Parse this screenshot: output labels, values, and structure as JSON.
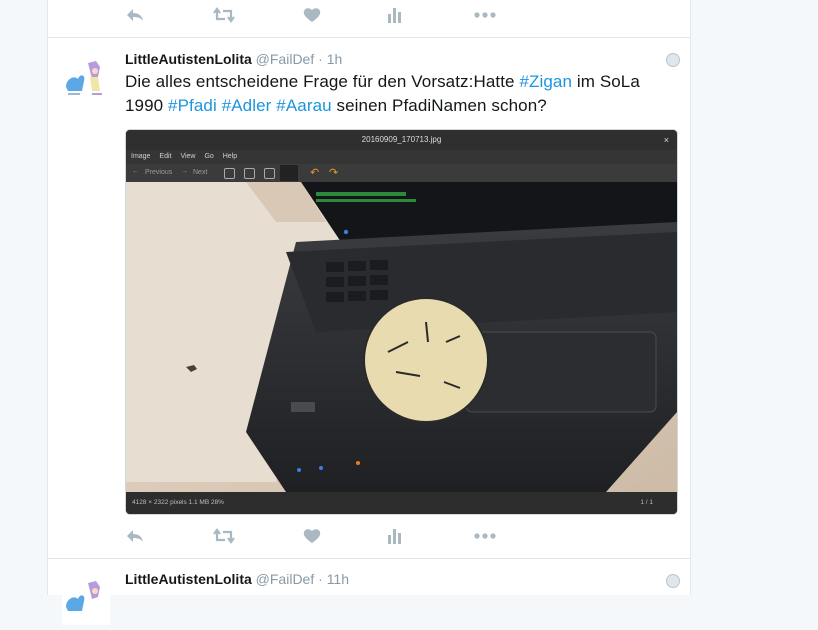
{
  "actions": {
    "reply_icon": "reply-icon",
    "retweet_icon": "retweet-icon",
    "like_icon": "heart-icon",
    "analytics_icon": "bar-chart-icon",
    "more_icon": "more-icon"
  },
  "tweets": [
    {
      "name": "LittleAutistenLolita",
      "handle": "@FailDef",
      "dot": "·",
      "time": "1h",
      "text": {
        "p1": "Die alles entscheidene Frage für den Vorsatz:Hatte ",
        "h1": "#Zigan",
        "p2": " im SoLa 1990 ",
        "h2": "#Pfadi",
        "h3": "#Adler",
        "h4": "#Aarau",
        "p3": " seinen PfadiNamen schon?"
      },
      "media": {
        "window_title": "20160909_170713.jpg",
        "close": "×",
        "menu": [
          "Image",
          "Edit",
          "View",
          "Go",
          "Help"
        ],
        "prev": "Previous",
        "next": "Next",
        "status_left": "4128 × 2322 pixels  1.1 MB   28%",
        "status_right": "1 / 1"
      }
    },
    {
      "name": "LittleAutistenLolita",
      "handle": "@FailDef",
      "dot": "·",
      "time": "11h"
    }
  ]
}
